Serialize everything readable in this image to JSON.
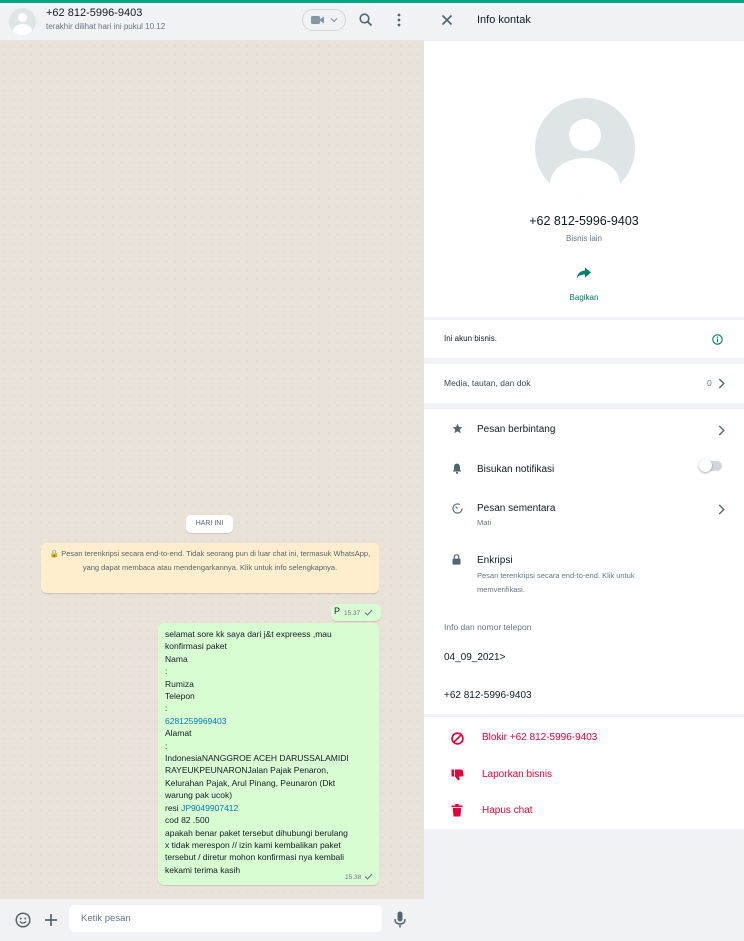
{
  "chat": {
    "contact_name": "+62 812-5996-9403",
    "last_seen": "terakhir dilihat hari ini pukul 10.12",
    "date_chip": "HARI INI",
    "encryption_notice": "🔒 Pesan terenkripsi secara end-to-end. Tidak seorang pun di luar chat ini, termasuk WhatsApp, yang dapat membaca atau mendengarkannya. Klik untuk info selengkapnya.",
    "messages": [
      {
        "text": "P",
        "time": "15.37",
        "status": "sent"
      },
      {
        "lines": [
          "selamat sore  kk saya dari j&t expreess ,mau",
          "konfirmasi paket",
          "Nama",
          ":",
          "Rumiza",
          "Telepon",
          ":",
          "6281259969403",
          "Alamat",
          ":",
          "IndonesiaNANGGROE ACEH DARUSSALAMIDI",
          "RAYEUKPEUNARONJalan Pajak Penaron,",
          "Kelurahan Pajak, Arul Pinang, Peunaron (Dkt",
          "warung pak ucok)",
          "resi JP9049907412",
          "cod 82 .500",
          "apakah benar paket tersebut  dihubungi berulang",
          "x tidak merespon  // izin kami kembalikan paket",
          "tersebut / diretur  mohon konfirmasi nya kembali",
          "kekami terima kasih"
        ],
        "time": "15.38",
        "status": "sent"
      }
    ],
    "composer_placeholder": "Ketik pesan"
  },
  "info": {
    "title": "Info kontak",
    "name": "+62 812-5996-9403",
    "subtitle": "Bisnis lain",
    "share_label": "Bagikan",
    "business_note": "Ini akun bisnis.",
    "media_label": "Media, tautan, dan dok",
    "media_count": "0",
    "starred_label": "Pesan berbintang",
    "mute_label": "Bisukan notifikasi",
    "disappearing_label": "Pesan sementara",
    "disappearing_value": "Mati",
    "encryption_label": "Enkripsi",
    "encryption_desc_1": "Pesan terenkripsi secara end-to-end. Klik untuk",
    "encryption_desc_2": "memverifikasi.",
    "about_section_title": "Info dan nomor telepon",
    "about": "04_09_2021>",
    "phone": "+62 812-5996-9403",
    "block_label": "Blokir +62 812-5996-9403",
    "report_label": "Laporkan bisnis",
    "delete_label": "Hapus chat"
  },
  "colors": {
    "accent": "#00a884",
    "outgoing_bubble": "#d9fdd3",
    "danger": "#ea0038",
    "link": "#027eb5"
  },
  "icons": [
    "video-icon",
    "search-icon",
    "menu-icon",
    "close-icon",
    "share-icon",
    "info-icon",
    "star-icon",
    "bell-icon",
    "timer-icon",
    "lock-icon",
    "block-icon",
    "thumbs-down-icon",
    "trash-icon",
    "emoji-icon",
    "plus-icon",
    "mic-icon"
  ]
}
